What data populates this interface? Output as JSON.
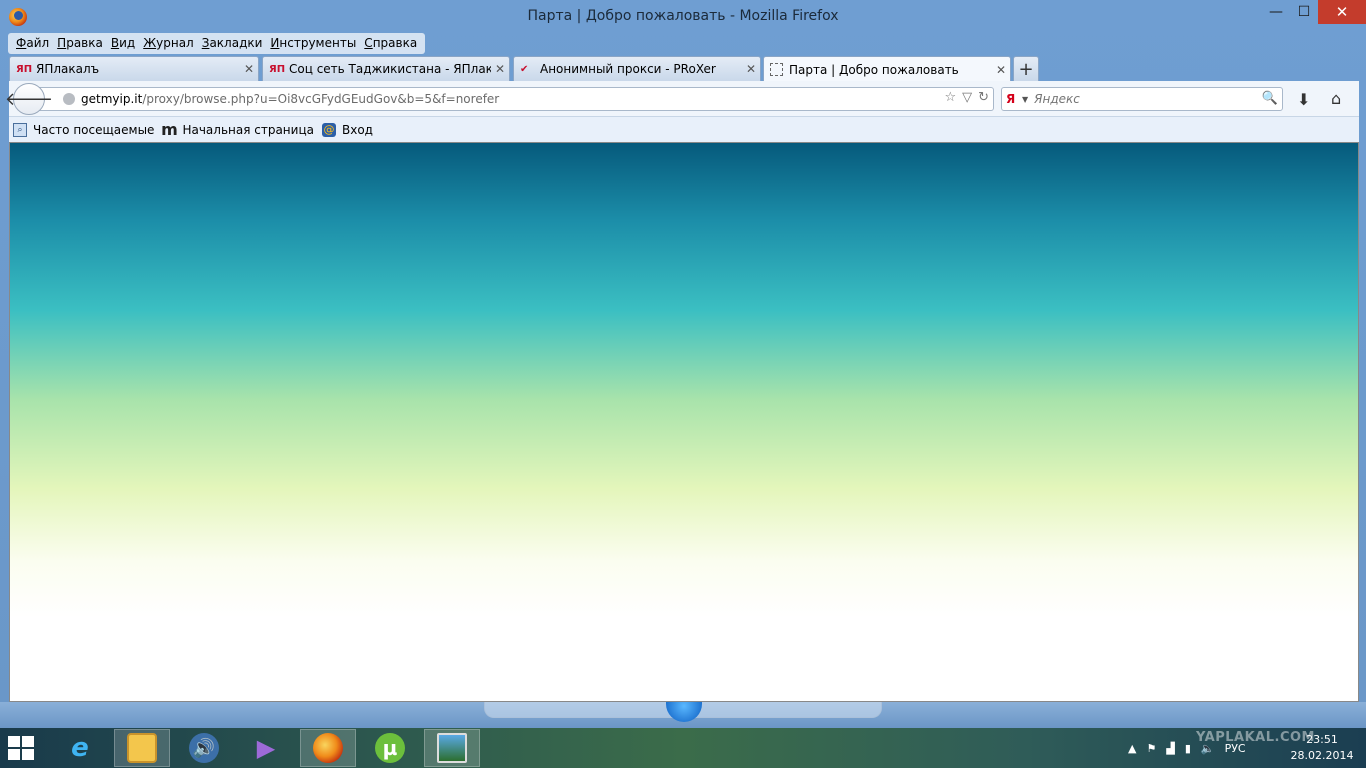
{
  "window": {
    "title": "Парта | Добро пожаловать - Mozilla Firefox",
    "min_glyph": "—",
    "max_glyph": "☐",
    "close_glyph": "✕"
  },
  "menu": [
    {
      "underline": "Ф",
      "rest": "айл"
    },
    {
      "underline": "П",
      "rest": "равка"
    },
    {
      "underline": "В",
      "rest": "ид"
    },
    {
      "underline": "Ж",
      "rest": "урнал"
    },
    {
      "underline": "З",
      "rest": "акладки"
    },
    {
      "underline": "И",
      "rest": "нструменты"
    },
    {
      "underline": "С",
      "rest": "правка"
    }
  ],
  "tabs": [
    {
      "label": "ЯПлакалъ",
      "favicon": "ЯП",
      "active": false
    },
    {
      "label": "Соц сеть Таджикистана - ЯПлакалъ",
      "favicon": "ЯП",
      "active": false
    },
    {
      "label": "Анонимный прокси - PRoXer",
      "favicon": "✔",
      "active": false
    },
    {
      "label": "Парта | Добро пожаловать",
      "favicon": "",
      "active": true
    }
  ],
  "tab_close_glyph": "✕",
  "new_tab_glyph": "+",
  "nav": {
    "back_glyph": "🡐",
    "url_host": "getmyip.it",
    "url_path": "/proxy/browse.php?u=Oi8vcGFydGEudGov&b=5&f=norefer",
    "bookmark_star": "☆",
    "dropdown_glyph": "▽",
    "reload_glyph": "↻"
  },
  "search": {
    "engine_glyph": "Я",
    "dropdown_glyph": "▼",
    "placeholder": "Яндекс",
    "go_glyph": "🔍"
  },
  "toolbar": {
    "download_glyph": "⬇",
    "home_glyph": "⌂"
  },
  "bookmarks": [
    {
      "label": "Часто посещаемые",
      "icon": "⌕"
    },
    {
      "label": "Начальная страница",
      "icon": "m"
    },
    {
      "label": "Вход",
      "icon": "@"
    }
  ],
  "taskbar": {
    "apps": [
      {
        "name": "Internet Explorer",
        "glyph": "e"
      },
      {
        "name": "File Explorer",
        "glyph": ""
      },
      {
        "name": "Volume",
        "glyph": "🔊"
      },
      {
        "name": "Visual Studio",
        "glyph": "▶"
      },
      {
        "name": "Firefox",
        "glyph": ""
      },
      {
        "name": "uTorrent",
        "glyph": "µ"
      },
      {
        "name": "Photos",
        "glyph": ""
      }
    ],
    "tray": {
      "chevron": "▲",
      "flag": "⚑",
      "signal": "▟",
      "battery": "▮",
      "volume": "🔈",
      "language": "РУС"
    },
    "clock_time": "23:51",
    "clock_date": "28.02.2014",
    "watermark": "YAPLAKAL.COM"
  },
  "colors": {
    "close_button": "#c43c2c",
    "gradient_top": "#065a7c",
    "gradient_mid": "#3bbfc2",
    "gradient_lower": "#a8e3ab",
    "gradient_bottom": "#ffffff"
  }
}
